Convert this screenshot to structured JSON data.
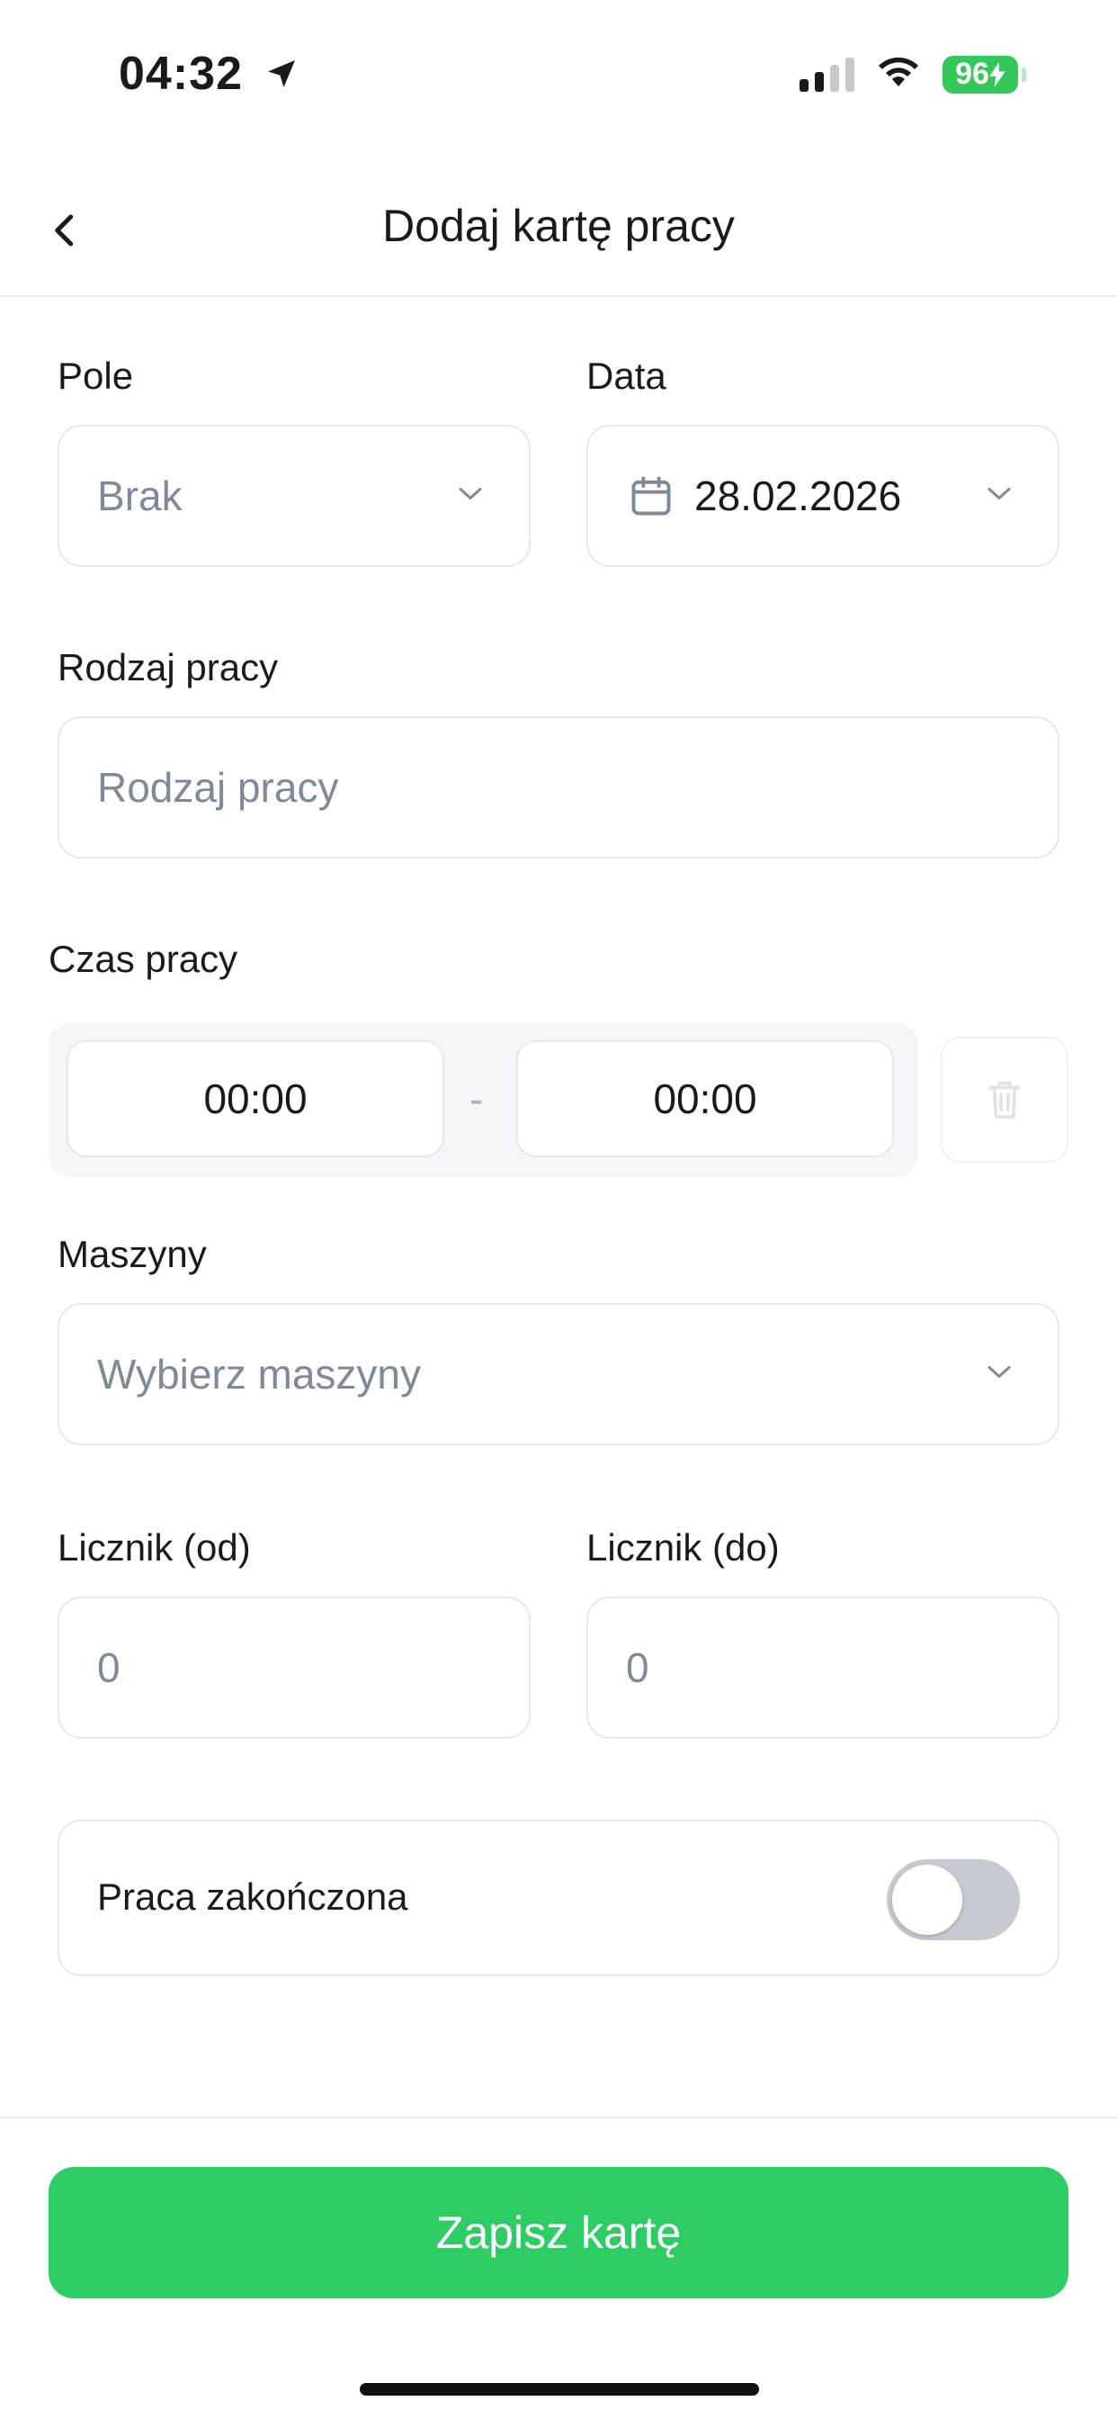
{
  "status_bar": {
    "time": "04:32",
    "battery": "96"
  },
  "header": {
    "title": "Dodaj kartę pracy"
  },
  "form": {
    "field": {
      "label": "Pole",
      "value": "Brak"
    },
    "date": {
      "label": "Data",
      "value": "28.02.2026"
    },
    "work_type": {
      "label": "Rodzaj pracy",
      "placeholder": "Rodzaj pracy"
    },
    "work_time": {
      "label": "Czas pracy",
      "from": "00:00",
      "separator": "-",
      "to": "00:00"
    },
    "machines": {
      "label": "Maszyny",
      "placeholder": "Wybierz maszyny"
    },
    "counter_from": {
      "label": "Licznik (od)",
      "placeholder": "0"
    },
    "counter_to": {
      "label": "Licznik (do)",
      "placeholder": "0"
    },
    "completed": {
      "label": "Praca zakończona",
      "on": false
    }
  },
  "footer": {
    "save_label": "Zapisz kartę"
  },
  "colors": {
    "accent": "#2ecc65",
    "battery": "#34c759"
  }
}
